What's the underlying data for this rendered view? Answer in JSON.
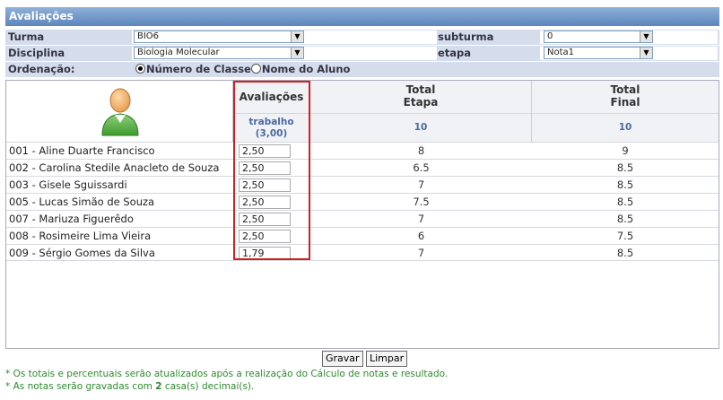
{
  "window": {
    "title": "Avaliações"
  },
  "filters": {
    "turma_label": "Turma",
    "turma_value": "BIO6",
    "subturma_label": "subturma",
    "subturma_value": "0",
    "disciplina_label": "Disciplina",
    "disciplina_value": "Biologia Molecular",
    "etapa_label": "etapa",
    "etapa_value": "Nota1",
    "ordenacao_label": "Ordenação:",
    "order_option_1": "Número de Classe",
    "order_option_2": "Nome do Aluno"
  },
  "grid": {
    "col_avaliacoes": "Avaliações",
    "col_avaliacoes_sub1": "trabalho",
    "col_avaliacoes_sub2": "(3,00)",
    "col_total_etapa_1": "Total",
    "col_total_etapa_2": "Etapa",
    "col_total_etapa_sub": "10",
    "col_total_final_1": "Total",
    "col_total_final_2": "Final",
    "col_total_final_sub": "10",
    "rows": [
      {
        "name": "001 - Aline Duarte Francisco",
        "note": "2,50",
        "etapa": "8",
        "final": "9"
      },
      {
        "name": "002 - Carolina Stedile Anacleto de Souza",
        "note": "2,50",
        "etapa": "6.5",
        "final": "8.5"
      },
      {
        "name": "003 - Gisele Sguissardi",
        "note": "2,50",
        "etapa": "7",
        "final": "8.5"
      },
      {
        "name": "005 - Lucas Simão de Souza",
        "note": "2,50",
        "etapa": "7.5",
        "final": "8.5"
      },
      {
        "name": "007 - Mariuza Figuerêdo",
        "note": "2,50",
        "etapa": "7",
        "final": "8.5"
      },
      {
        "name": "008 - Rosimeire Lima Vieira",
        "note": "2,50",
        "etapa": "6",
        "final": "7.5"
      },
      {
        "name": "009 - Sérgio Gomes da Silva",
        "note": "1,79",
        "etapa": "7",
        "final": "8.5"
      }
    ]
  },
  "buttons": {
    "save": "Gravar",
    "clear": "Limpar"
  },
  "footer": {
    "note1": "* Os totais e percentuais serão atualizados após a realização do Cálculo de notas e resultado.",
    "note2_a": "* As notas serão gravadas com ",
    "note2_b": "2",
    "note2_c": " casa(s) decimai(s)."
  },
  "icons": {
    "select_arrow": "chevron-down-icon",
    "student": "user-avatar-icon"
  },
  "colors": {
    "title_bar": "#6f94c8",
    "filter_bg": "#d5dded",
    "highlight_box": "#cc2222",
    "footer_text": "#2f8a2f"
  }
}
